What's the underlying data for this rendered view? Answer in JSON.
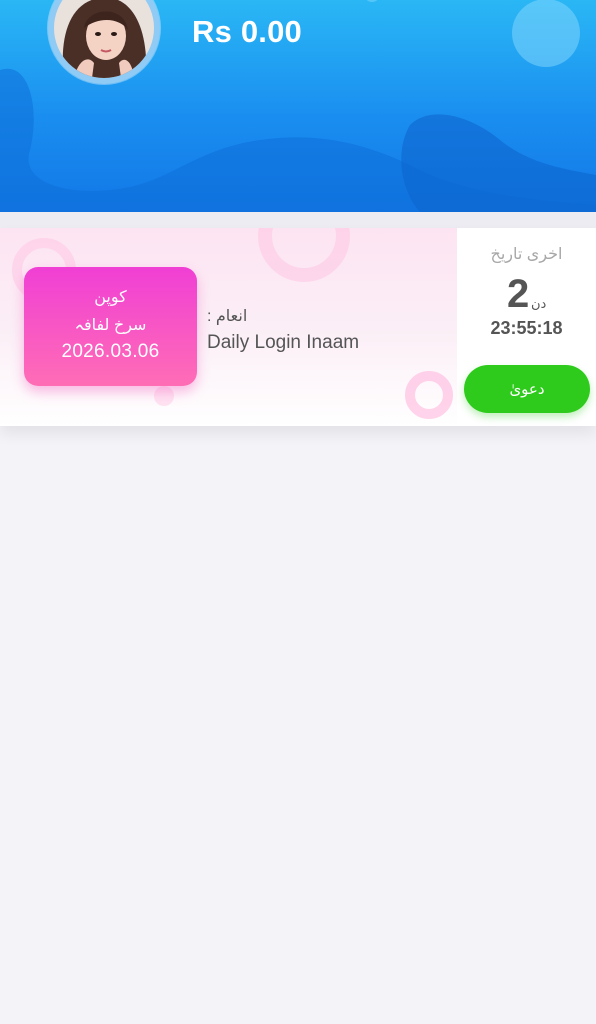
{
  "header": {
    "balance": "Rs 0.00",
    "colors": {
      "gradient_top": "#2ab7f5",
      "gradient_bottom": "#1277e6"
    }
  },
  "coupon": {
    "type_label": "کوپن",
    "name": "سرخ لفافہ",
    "date": "2026.03.06",
    "color": "#f03fd5"
  },
  "reward": {
    "label": ": انعام",
    "value": "Daily Login Inaam"
  },
  "expiry": {
    "label": "اخری تاریخ",
    "days": "2",
    "days_unit": "دن",
    "countdown": "23:55:18"
  },
  "actions": {
    "claim_label": "دعویٰ",
    "claim_color": "#2ecb1d"
  }
}
